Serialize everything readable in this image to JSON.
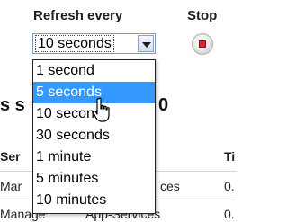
{
  "header": {
    "refresh_label": "Refresh every",
    "stop_label": "Stop"
  },
  "refresh_select": {
    "value": "10 seconds",
    "options": [
      "1 second",
      "5 seconds",
      "10 seconds",
      "30 seconds",
      "1 minute",
      "5 minutes",
      "10 minutes"
    ],
    "highlighted_index": 1
  },
  "background": {
    "heading": "s s",
    "heading_tail": "0",
    "columns": [
      "Ser",
      "Ti"
    ],
    "rows": [
      {
        "col1": "Mar",
        "col2": "ces",
        "col3": "0."
      },
      {
        "col1": "Manage",
        "col2": "App-Services",
        "col3": "0."
      }
    ]
  },
  "colors": {
    "highlight": "#3399ff",
    "stop_square": "#e0242c"
  },
  "icons": {
    "dropdown_arrow": "chevron-down-icon",
    "stop": "stop-icon",
    "cursor": "hand-pointer-icon"
  }
}
